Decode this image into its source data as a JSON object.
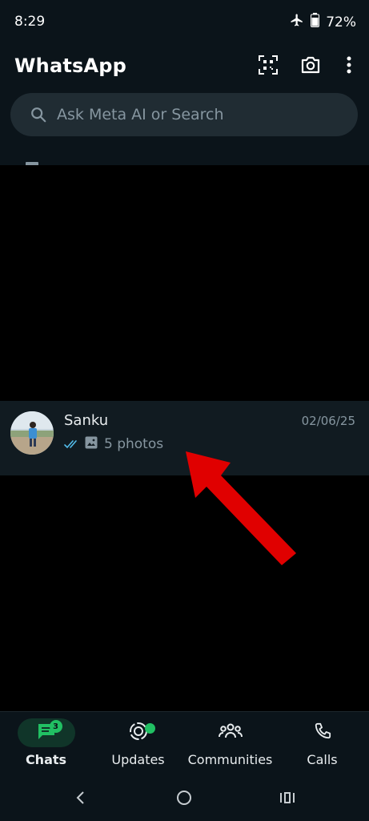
{
  "status_bar": {
    "time": "8:29",
    "battery": "72%",
    "icons": [
      "airplane-mode-icon",
      "battery-icon"
    ]
  },
  "header": {
    "title": "WhatsApp",
    "icons": [
      "qr-scanner-icon",
      "camera-icon",
      "more-options-icon"
    ]
  },
  "search": {
    "placeholder": "Ask Meta AI or Search",
    "icon": "search-icon"
  },
  "chats": [
    {
      "name": "Sanku",
      "date": "02/06/25",
      "preview": "5 photos",
      "status_icon": "double-check-read-icon",
      "media_icon": "photo-icon"
    }
  ],
  "bottom_nav": {
    "items": [
      {
        "label": "Chats",
        "icon": "chats-icon",
        "active": true,
        "badge": "3"
      },
      {
        "label": "Updates",
        "icon": "updates-icon",
        "active": false,
        "dot": true
      },
      {
        "label": "Communities",
        "icon": "communities-icon",
        "active": false
      },
      {
        "label": "Calls",
        "icon": "calls-icon",
        "active": false
      }
    ]
  },
  "system_nav": [
    "back-icon",
    "home-icon",
    "recents-icon"
  ],
  "colors": {
    "background": "#000000",
    "header_bg": "#0b141a",
    "search_bg": "#202c33",
    "chat_row_bg": "#111b21",
    "accent_green": "#21c063",
    "read_tick_blue": "#53bdeb",
    "annotation_red": "#e00000",
    "secondary_text": "#8696a0"
  }
}
